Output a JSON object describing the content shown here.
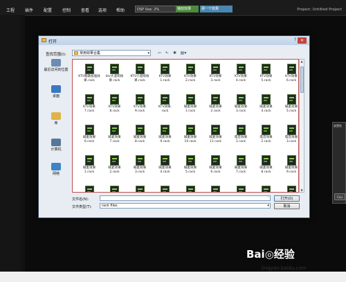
{
  "menubar": {
    "items": [
      "工程",
      "插件",
      "配置",
      "控制",
      "查看",
      "选项",
      "帮助"
    ],
    "dsp_status": "DSP Use: 2%",
    "green_box": "播放效果",
    "blue_box": "那一个效果",
    "project_title": "Project: Untitled Project"
  },
  "right_panel": {
    "tab": "放置框",
    "button": "Cou"
  },
  "dialog": {
    "title": "打开",
    "lookin_label": "查找范围(I):",
    "lookin_value": "常用效果合集",
    "toolbar_icons": [
      "back-icon",
      "up-folder-icon",
      "new-folder-icon",
      "view-menu-icon"
    ],
    "toolbar_glyphs": [
      "⇦",
      "⬑",
      "✱",
      "▤▾"
    ],
    "places": [
      {
        "label": "最近访问的位置",
        "icon": "recent-places-icon",
        "color": "#6d8db0"
      },
      {
        "label": "桌面",
        "icon": "desktop-icon",
        "color": "#3a78c2"
      },
      {
        "label": "库",
        "icon": "libraries-icon",
        "color": "#e0b34a"
      },
      {
        "label": "计算机",
        "icon": "computer-icon",
        "color": "#557799"
      },
      {
        "label": "网络",
        "icon": "network-icon",
        "color": "#3d84c6"
      }
    ],
    "files": [
      "KTV唱歌加强效果.rack",
      "ktv大混响效果.rack",
      "KTV小混响效果.rack",
      "KTV效果\n1.rack",
      "KTV效果\n2.rack",
      "KTV效果\n3.rack",
      "KTV效果\n4.rack",
      "KTV效果\n5.rack",
      "KTV效果\n6.rack",
      "KTV效果\n7.rack",
      "KTV效果\n8.rack",
      "KTV效果\n9.rack",
      "KTV效果.\nrack",
      "喊麦效果\n1.rack",
      "喊麦效果\n2.rack",
      "喊麦效果\n3.rack",
      "喊麦效果\n4.rack",
      "喊麦效果\n5.rack",
      "喊麦效果\n6.rack",
      "喊麦效果\n7.rack",
      "喊麦效果\n8.rack",
      "喊麦效果\n9.rack",
      "喊麦效果\n10.rack",
      "喊麦效果\n11.rack",
      "电音效果\n1.rack",
      "电音效果\n2.rack",
      "电音效果\n3.rack",
      "喊麦效果\n1.rack",
      "喊麦效果\n2.rack",
      "喊麦效果\n3.rack",
      "喊麦效果\n4.rack",
      "喊麦效果\n5.rack",
      "喊麦效果\n6.rack",
      "喊麦效果\n7.rack",
      "喊麦效果\n8.rack",
      "喊麦效果\n9.rack",
      "",
      "",
      "",
      "",
      "",
      "",
      "",
      "",
      ""
    ],
    "filename_label": "文件名(N):",
    "filename_value": "",
    "filetype_label": "文件类型(T):",
    "filetype_value": "rack files",
    "open_label": "打开(O)",
    "cancel_label": "取消"
  },
  "watermark": {
    "logo": "Bai◎经验",
    "url": "jingyan.baidu.com"
  }
}
